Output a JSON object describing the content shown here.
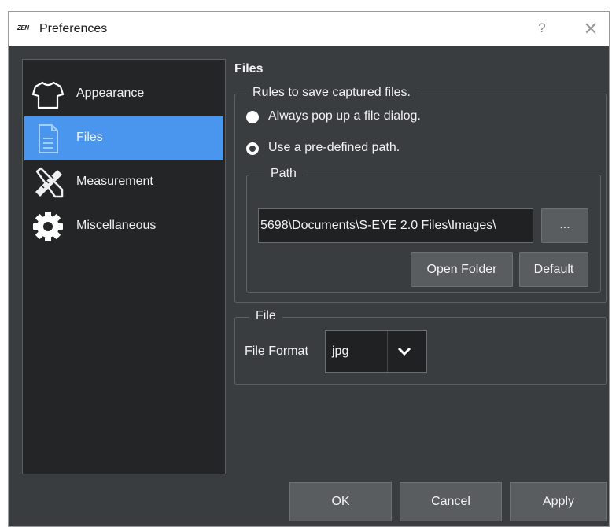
{
  "window": {
    "title": "Preferences",
    "logo_text": "ZEN",
    "help_glyph": "?",
    "close_glyph": "✕"
  },
  "nav": {
    "items": [
      {
        "label": "Appearance",
        "icon": "shirt-icon",
        "active": false
      },
      {
        "label": "Files",
        "icon": "document-icon",
        "active": true
      },
      {
        "label": "Measurement",
        "icon": "ruler-pencil-icon",
        "active": false
      },
      {
        "label": "Miscellaneous",
        "icon": "gear-icon",
        "active": false
      }
    ]
  },
  "files": {
    "section_title": "Files",
    "rules_group": {
      "legend": "Rules to save captured files.",
      "option_dialog": "Always pop up a file dialog.",
      "option_path": "Use a pre-defined path.",
      "selected": "option_path"
    },
    "path_group": {
      "legend": "Path",
      "value": "5698\\Documents\\S-EYE 2.0 Files\\Images\\",
      "browse_label": "...",
      "open_folder_label": "Open Folder",
      "default_label": "Default"
    },
    "file_group": {
      "legend": "File",
      "format_label": "File Format",
      "format_value": "jpg"
    }
  },
  "footer": {
    "ok_label": "OK",
    "cancel_label": "Cancel",
    "apply_label": "Apply"
  },
  "colors": {
    "accent": "#4a96ee",
    "background": "#3a3d40",
    "panel": "#232527"
  }
}
